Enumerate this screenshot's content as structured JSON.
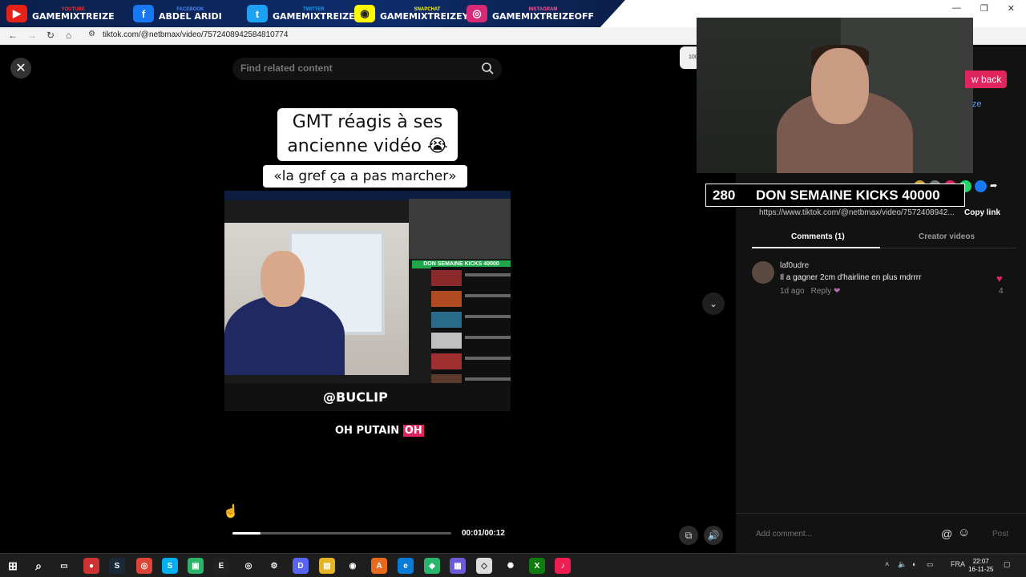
{
  "overlay": {
    "socials": [
      {
        "top": "YOUTUBE",
        "name": "GAMEMIXTREIZE",
        "icon": "youtube-icon",
        "color": "#e62117"
      },
      {
        "top": "FACEBOOK",
        "name": "ABDEL ARIDI",
        "icon": "facebook-icon",
        "color": "#1877f2"
      },
      {
        "top": "TWITTER",
        "name": "GAMEMIXTREIZE",
        "icon": "twitter-icon",
        "color": "#1da1f2"
      },
      {
        "top": "SNAPCHAT",
        "name": "GAMEMIXTREIZEYT",
        "icon": "snapchat-icon",
        "color": "#fffc00"
      },
      {
        "top": "INSTAGRAM",
        "name": "GAMEMIXTREIZEOFF",
        "icon": "instagram-icon",
        "color": "#d62976"
      }
    ]
  },
  "browser": {
    "url": "tiktok.com/@netbmax/video/7572408942584810774"
  },
  "player": {
    "search_placeholder": "Find related content",
    "caption_line1": "GMT réagis à ses",
    "caption_line2": "ancienne vidéo 😭",
    "caption_quote": "«la gref ça a pas marcher»",
    "watermark": "@BUCLIP",
    "inner_banner": "DON SEMAINE KICKS 40000",
    "subtitle_main": "OH PUTAIN",
    "subtitle_highlight": "OH",
    "time": "00:01/00:12",
    "progress": 0.13
  },
  "stream": {
    "go_back": "w back",
    "side_link": "ze",
    "kicks_count": "280",
    "kicks_label": "DON SEMAINE KICKS 40000"
  },
  "sidebar": {
    "link": "https://www.tiktok.com/@netbmax/video/7572408942...",
    "copy_link": "Copy link",
    "tab_comments": "Comments (1)",
    "tab_creator": "Creator videos",
    "comment": {
      "user": "laf0udre",
      "text": "Il a gagner 2cm d'hairline en plus mdrrrr",
      "time": "1d ago",
      "reply": "Reply",
      "likes": "4"
    },
    "add_comment_placeholder": "Add comment...",
    "post": "Post",
    "side_small": "100"
  },
  "taskbar": {
    "lang": "FRA",
    "time": "22:07",
    "date": "16-11-25"
  }
}
